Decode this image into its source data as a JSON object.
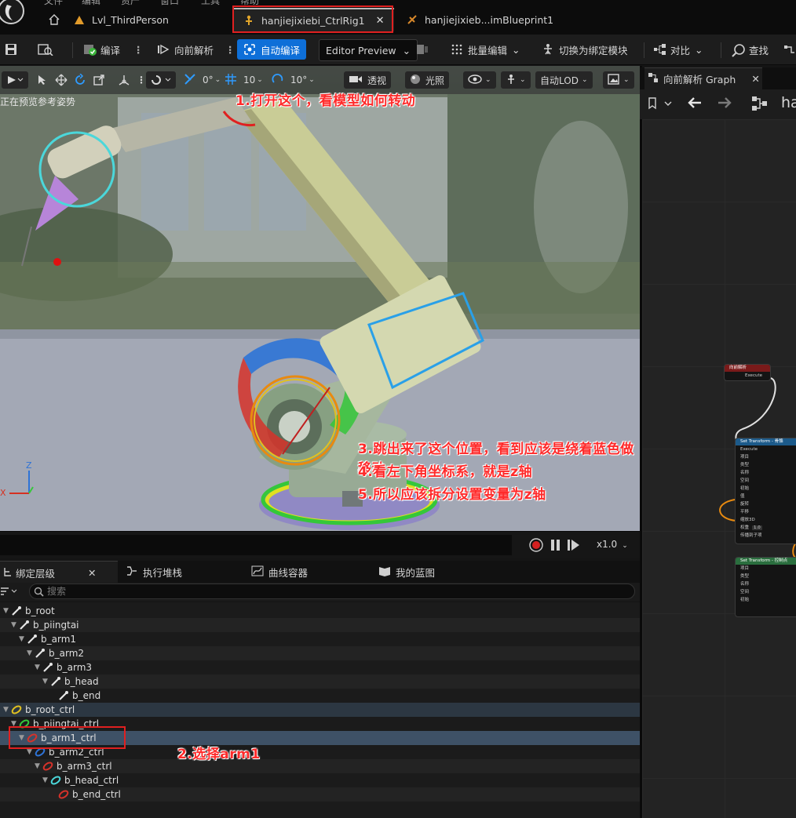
{
  "menu": {
    "items": [
      "文件",
      "编辑",
      "资产",
      "窗口",
      "工具",
      "帮助"
    ]
  },
  "tabs": [
    {
      "label": "Lvl_ThirdPerson"
    },
    {
      "label": "hanjiejixiebi_CtrlRig1"
    },
    {
      "label": "hanjiejixieb...imBlueprint1"
    }
  ],
  "toolbar": {
    "compile": "编译",
    "forward_solve": "向前解析",
    "auto_compile": "自动编译",
    "editor_preview": "Editor Preview",
    "bulk_edit": "批量编辑",
    "switch_binding": "切换为绑定模块",
    "diff": "对比",
    "find": "查找"
  },
  "viewport": {
    "toolbar": {
      "angle_snap": "0°",
      "grid_snap": "10",
      "rotation_snap": "10°",
      "perspective": "透视",
      "lighting": "光照",
      "lod": "自动LOD"
    },
    "status": "正在预览参考姿势",
    "axis_labels": {
      "z": "Z",
      "x": "X"
    }
  },
  "annotations": {
    "step1": "1.打开这个，看模型如何转动",
    "step2": "2.选择arm1",
    "step3": "3.跳出来了这个位置，看到应该是绕着蓝色做移动",
    "step4": "4.看左下角坐标系，就是z轴",
    "step5": "5.所以应该拆分设置变量为z轴"
  },
  "playback": {
    "speed": "x1.0"
  },
  "panel_tabs": [
    {
      "label": "绑定层级",
      "closable": true
    },
    {
      "label": "执行堆栈"
    },
    {
      "label": "曲线容器"
    },
    {
      "label": "我的蓝图"
    }
  ],
  "search": {
    "placeholder": "搜索"
  },
  "hierarchy": [
    {
      "label": "b_root",
      "depth": 0,
      "kind": "bone"
    },
    {
      "label": "b_piingtai",
      "depth": 1,
      "kind": "bone"
    },
    {
      "label": "b_arm1",
      "depth": 2,
      "kind": "bone"
    },
    {
      "label": "b_arm2",
      "depth": 3,
      "kind": "bone"
    },
    {
      "label": "b_arm3",
      "depth": 4,
      "kind": "bone"
    },
    {
      "label": "b_head",
      "depth": 5,
      "kind": "bone"
    },
    {
      "label": "b_end",
      "depth": 6,
      "kind": "bone"
    },
    {
      "label": "b_root_ctrl",
      "depth": 0,
      "kind": "ctrl-yellow"
    },
    {
      "label": "b_piingtai_ctrl",
      "depth": 1,
      "kind": "ctrl-green"
    },
    {
      "label": "b_arm1_ctrl",
      "depth": 2,
      "kind": "ctrl-red",
      "selected": true
    },
    {
      "label": "b_arm2_ctrl",
      "depth": 3,
      "kind": "ctrl-blue"
    },
    {
      "label": "b_arm3_ctrl",
      "depth": 4,
      "kind": "ctrl-red"
    },
    {
      "label": "b_head_ctrl",
      "depth": 5,
      "kind": "ctrl-cyan"
    },
    {
      "label": "b_end_ctrl",
      "depth": 6,
      "kind": "ctrl-red"
    }
  ],
  "graph": {
    "tab_label": "向前解析 Graph",
    "breadcrumb": "ha",
    "nodes": {
      "forward": {
        "title": "向前解析",
        "pin": "Execute"
      },
      "set_transform_1": {
        "title": "Set Transform - 骨骼",
        "rows": [
          "Execute",
          "项目",
          "类型",
          "名称",
          "空间",
          "初始",
          "值",
          "旋转",
          "平移",
          "缩放3D",
          "权重",
          "传播到子项"
        ],
        "weight": "1.0"
      },
      "set_transform_2": {
        "title": "Set Transform - 控制点",
        "rows": [
          "项目",
          "类型",
          "名称",
          "空间",
          "初始"
        ]
      }
    }
  },
  "colors": {
    "accent": "#0e6fd8",
    "annotation": "#ff2a2a",
    "selection_row": "#3e5166",
    "gizmo_blue": "#2e73d6",
    "gizmo_red": "#d6322a",
    "gizmo_green": "#35c73a",
    "gizmo_yellow": "#e0b020"
  }
}
